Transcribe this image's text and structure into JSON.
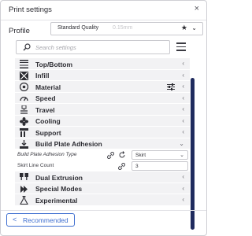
{
  "window": {
    "title": "Print settings",
    "close_glyph": "×"
  },
  "profile": {
    "label": "Profile",
    "value": "Standard Quality",
    "sub": "0.15mm",
    "star_glyph": "★",
    "chevron_glyph": "⌄"
  },
  "search": {
    "placeholder": "Search settings"
  },
  "categories": [
    {
      "label": "Top/Bottom",
      "icon": "top-bottom-icon"
    },
    {
      "label": "Infill",
      "icon": "infill-icon"
    },
    {
      "label": "Material",
      "icon": "material-icon",
      "extra_icon": "sliders-icon"
    },
    {
      "label": "Speed",
      "icon": "speed-icon"
    },
    {
      "label": "Travel",
      "icon": "travel-icon"
    },
    {
      "label": "Cooling",
      "icon": "cooling-icon"
    },
    {
      "label": "Support",
      "icon": "support-icon"
    },
    {
      "label": "Build Plate Adhesion",
      "icon": "build-plate-icon",
      "expanded": true
    },
    {
      "label": "Dual Extrusion",
      "icon": "dual-extrusion-icon"
    },
    {
      "label": "Special Modes",
      "icon": "special-modes-icon"
    },
    {
      "label": "Experimental",
      "icon": "experimental-icon"
    }
  ],
  "settings": [
    {
      "label": "Build Plate Adhesion Type",
      "value": "Skirt"
    },
    {
      "label": "Skirt Line Count",
      "value": "3"
    }
  ],
  "arrow_collapsed": "‹",
  "arrow_expanded": "⌄",
  "footer": {
    "button_label": "Recommended",
    "button_glyph": "<"
  },
  "colors": {
    "accent": "#3f6fd0",
    "scrollbar": "#1f2b5e"
  }
}
